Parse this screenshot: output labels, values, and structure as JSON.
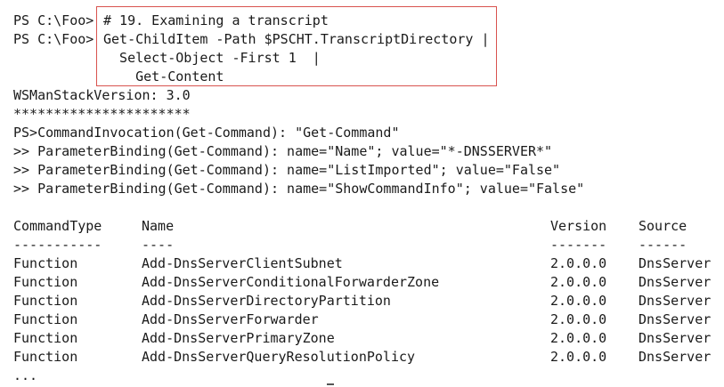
{
  "session": {
    "prompt": "PS C:\\Foo>",
    "command_lines": [
      "# 19. Examining a transcript",
      "Get-ChildItem -Path $PSCHT.TranscriptDirectory |",
      "  Select-Object -First 1  |",
      "    Get-Content"
    ]
  },
  "output": {
    "lines": [
      "WSManStackVersion: 3.0",
      "**********************",
      "PS>CommandInvocation(Get-Command): \"Get-Command\"",
      ">> ParameterBinding(Get-Command): name=\"Name\"; value=\"*-DNSSERVER*\"",
      ">> ParameterBinding(Get-Command): name=\"ListImported\"; value=\"False\"",
      ">> ParameterBinding(Get-Command): name=\"ShowCommandInfo\"; value=\"False\""
    ]
  },
  "table": {
    "headers": [
      "CommandType",
      "Name",
      "Version",
      "Source"
    ],
    "underlines": [
      "-----------",
      "----",
      "-------",
      "------"
    ],
    "rows": [
      [
        "Function",
        "Add-DnsServerClientSubnet",
        "2.0.0.0",
        "DnsServer"
      ],
      [
        "Function",
        "Add-DnsServerConditionalForwarderZone",
        "2.0.0.0",
        "DnsServer"
      ],
      [
        "Function",
        "Add-DnsServerDirectoryPartition",
        "2.0.0.0",
        "DnsServer"
      ],
      [
        "Function",
        "Add-DnsServerForwarder",
        "2.0.0.0",
        "DnsServer"
      ],
      [
        "Function",
        "Add-DnsServerPrimaryZone",
        "2.0.0.0",
        "DnsServer"
      ],
      [
        "Function",
        "Add-DnsServerQueryResolutionPolicy",
        "2.0.0.0",
        "DnsServer"
      ]
    ],
    "ellipsis": "..."
  },
  "colors": {
    "highlight_border": "#d9534f",
    "text": "#1a1a1a",
    "background": "#ffffff"
  }
}
